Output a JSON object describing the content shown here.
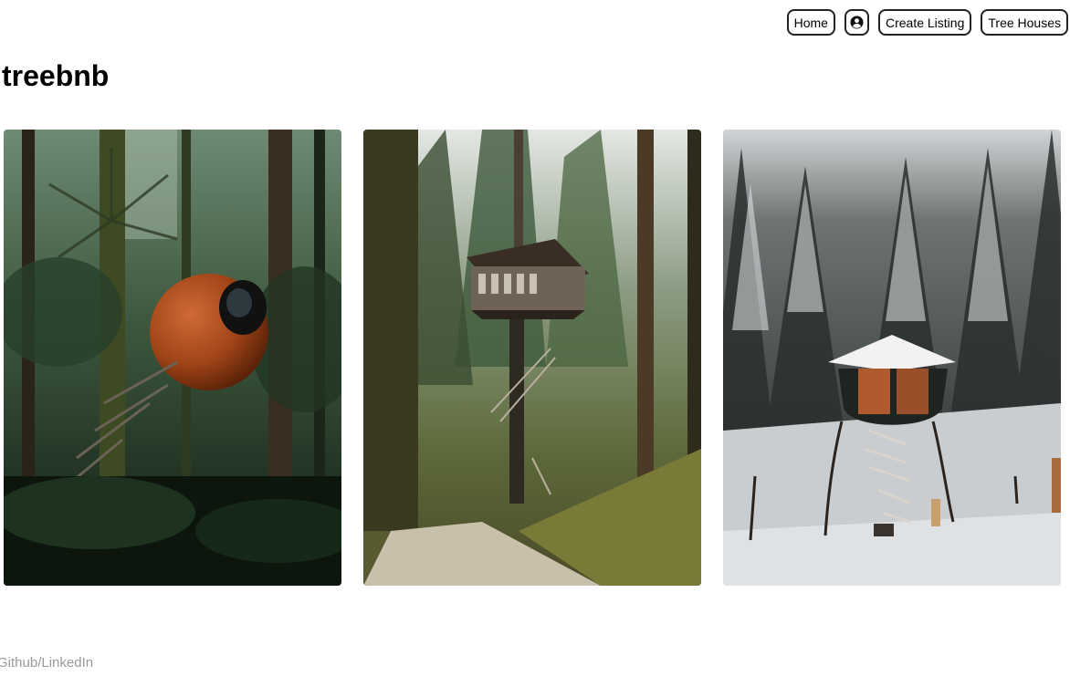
{
  "nav": {
    "home_label": "Home",
    "profile_icon": "user-circle-icon",
    "create_label": "Create Listing",
    "tree_houses_label": "Tree Houses"
  },
  "brand": {
    "title": "treebnb"
  },
  "listings": [
    {
      "image": "sphere-treehouse-photo",
      "scene": "forest"
    },
    {
      "image": "tower-treehouse-photo",
      "scene": "autumn-forest-road"
    },
    {
      "image": "snowy-treehouse-photo",
      "scene": "snowy-forest"
    }
  ],
  "footer": {
    "links_label": "Github/LinkedIn"
  }
}
